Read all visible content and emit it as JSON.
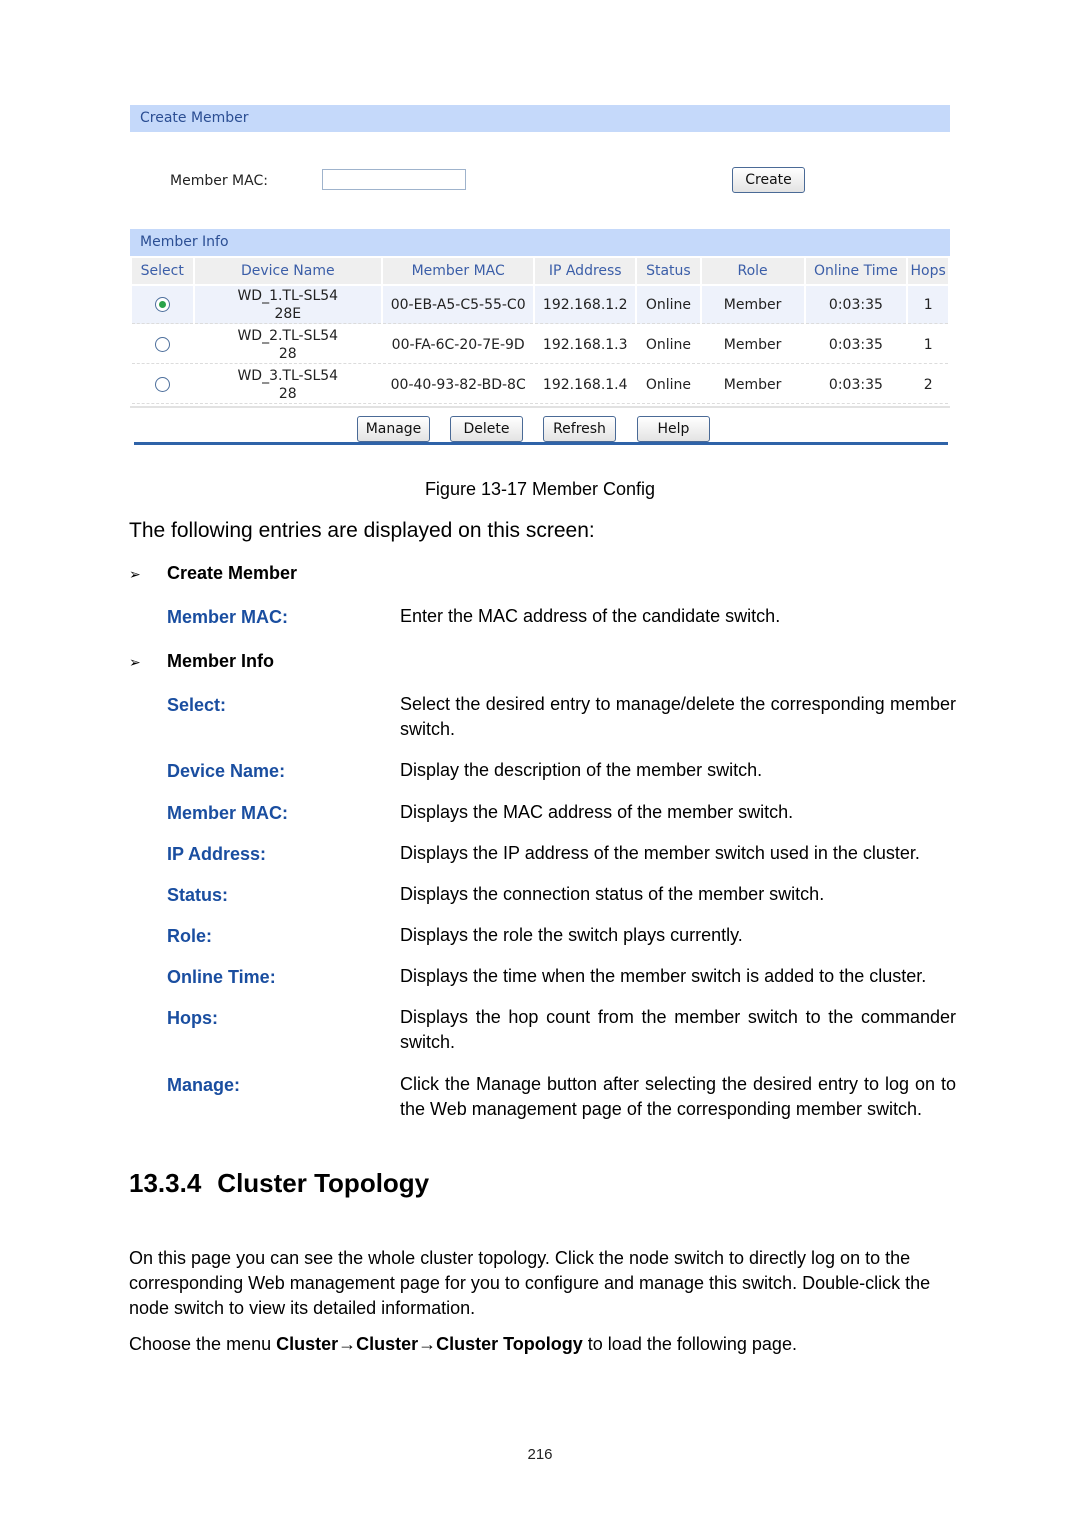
{
  "screenshot": {
    "create_member": {
      "section_title": "Create Member",
      "member_mac_label": "Member MAC:",
      "member_mac_value": "",
      "create_button": "Create"
    },
    "member_info": {
      "section_title": "Member Info",
      "columns": [
        "Select",
        "Device Name",
        "Member MAC",
        "IP Address",
        "Status",
        "Role",
        "Online Time",
        "Hops"
      ],
      "rows": [
        {
          "selected": true,
          "device_name_line1": "WD_1.TL-SL54",
          "device_name_line2": "28E",
          "member_mac": "00-EB-A5-C5-55-C0",
          "ip_address": "192.168.1.2",
          "status": "Online",
          "role": "Member",
          "online_time": "0:03:35",
          "hops": "1"
        },
        {
          "selected": false,
          "device_name_line1": "WD_2.TL-SL54",
          "device_name_line2": "28",
          "member_mac": "00-FA-6C-20-7E-9D",
          "ip_address": "192.168.1.3",
          "status": "Online",
          "role": "Member",
          "online_time": "0:03:35",
          "hops": "1"
        },
        {
          "selected": false,
          "device_name_line1": "WD_3.TL-SL54",
          "device_name_line2": "28",
          "member_mac": "00-40-93-82-BD-8C",
          "ip_address": "192.168.1.4",
          "status": "Online",
          "role": "Member",
          "online_time": "0:03:35",
          "hops": "2"
        }
      ],
      "buttons": {
        "manage": "Manage",
        "delete": "Delete",
        "refresh": "Refresh",
        "help": "Help"
      }
    }
  },
  "doc": {
    "figure_caption": "Figure 13-17 Member Config",
    "intro": "The following entries are displayed on this screen:",
    "bullet_arrow": "➢",
    "create_member_heading": "Create Member",
    "create_member_entries": [
      {
        "term": "Member MAC:",
        "desc": "Enter the MAC address of the candidate switch."
      }
    ],
    "member_info_heading": "Member Info",
    "member_info_entries": [
      {
        "term": "Select:",
        "desc": "Select the desired entry to manage/delete the corresponding member switch."
      },
      {
        "term": "Device Name:",
        "desc": "Display the description of the member switch."
      },
      {
        "term": "Member MAC:",
        "desc": "Displays the MAC address of the member switch."
      },
      {
        "term": "IP Address:",
        "desc": "Displays the IP address of the member switch used in the cluster."
      },
      {
        "term": "Status:",
        "desc": "Displays the connection status of the member switch."
      },
      {
        "term": "Role:",
        "desc": "Displays the role the switch plays currently."
      },
      {
        "term": "Online Time:",
        "desc": "Displays the time when the member switch is added to the cluster."
      },
      {
        "term": "Hops:",
        "desc": "Displays the hop count from the member switch to the commander switch."
      },
      {
        "term": "Manage:",
        "desc": "Click the Manage button after selecting the desired entry to log on to the Web management page of the corresponding member switch."
      }
    ],
    "section_number": "13.3.4",
    "section_title": "Cluster Topology",
    "paragraph": "On this page you can see the whole cluster topology. Click the node switch to directly log on to the corresponding Web management page for you to configure and manage this switch. Double-click the node switch to view its detailed information.",
    "menu_sentence": {
      "prefix": "Choose the menu ",
      "path": "Cluster→Cluster→Cluster Topology",
      "suffix": " to load the following page."
    },
    "page_number": "216"
  }
}
